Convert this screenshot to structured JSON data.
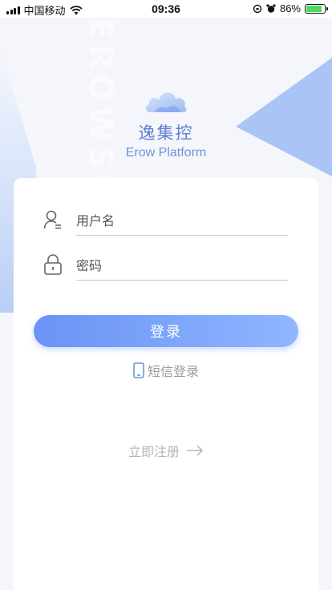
{
  "status_bar": {
    "carrier": "中国移动",
    "time": "09:36",
    "battery_percent": "86%",
    "battery_level": 0.86
  },
  "brand": {
    "vertical_text": "EROWSOFT",
    "app_name": "逸集控",
    "platform_name": "Erow Platform",
    "accent_color": "#6f95d8"
  },
  "login_form": {
    "username_placeholder": "用户名",
    "password_placeholder": "密码",
    "login_button": "登录",
    "sms_login": "短信登录",
    "register_link": "立即注册"
  },
  "icons": {
    "user": "user-icon",
    "lock": "lock-icon",
    "phone": "phone-icon",
    "arrow": "arrow-right-icon",
    "cloud": "cloud-logo-icon"
  }
}
